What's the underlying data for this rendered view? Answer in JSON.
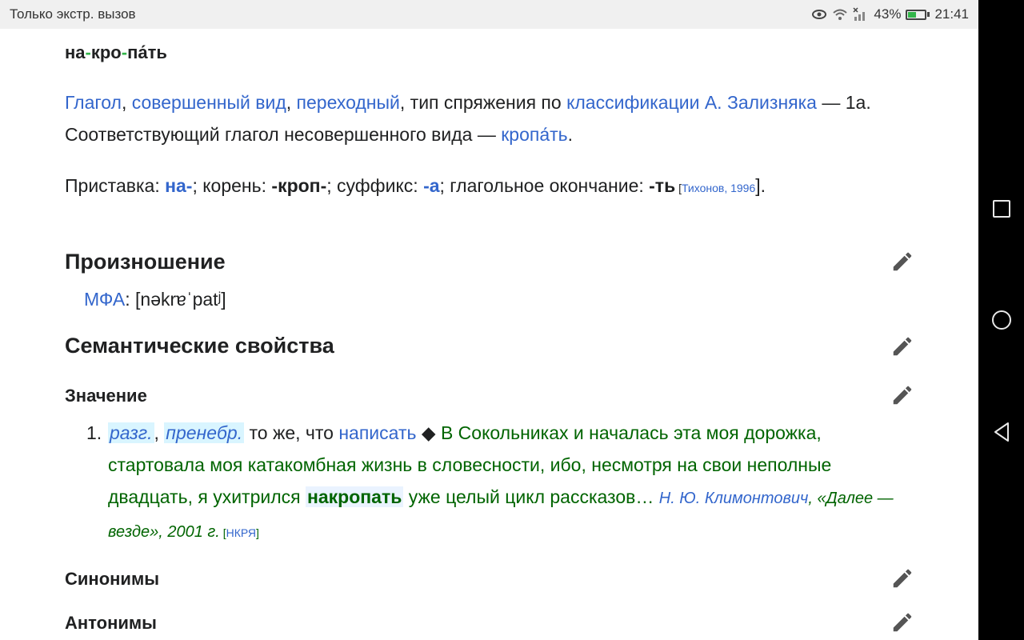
{
  "status_bar": {
    "left_text": "Только экстр. вызов",
    "battery": "43%",
    "time": "21:41"
  },
  "headword": {
    "p1": "на",
    "sep1": "-",
    "p2": "кро",
    "sep2": "-",
    "p3": "па́ть"
  },
  "grammar": {
    "verb": "Глагол",
    "comma1": ", ",
    "aspect": "совершенный вид",
    "comma2": ", ",
    "transitivity": "переходный",
    "conj_text": ", тип спряжения по ",
    "zaliznyak": "классификации А. Зализняка",
    "conj_type": " — 1a.",
    "imperfective_text": "Соответствующий глагол несовершенного вида — ",
    "imperfective_link": "кропа́ть",
    "period": "."
  },
  "morphemes": {
    "prefix_label": "Приставка: ",
    "prefix": "на-",
    "root_label": "; корень: ",
    "root": "-кроп-",
    "suffix_label": "; суффикс: ",
    "suffix": "-а",
    "ending_label": "; глагольное окончание: ",
    "ending": "-ть",
    "ref_open": " [",
    "ref": "Тихонов, 1996",
    "ref_close": "]."
  },
  "sections": {
    "pronunciation": "Произношение",
    "semantic": "Семантические свойства",
    "meaning": "Значение",
    "synonyms": "Синонимы",
    "antonyms": "Антонимы"
  },
  "ipa": {
    "label": "МФА",
    "value": ": [nəkrɐˈpatʲ]"
  },
  "meaning": {
    "number": "1.",
    "label1": "разг.",
    "comma": ", ",
    "label2": "пренебр.",
    "def_text": " то же, что ",
    "def_link": "написать",
    "diamond": " ◆ ",
    "example_before": "В Сокольниках и началась эта моя дорожка, стартовала моя катакомбная жизнь в словесности, ибо, несмотря на свои неполные двадцать, я ухитрился ",
    "example_highlight": "накропать",
    "example_after": " уже целый цикл рассказов… ",
    "author": "Н. Ю. Климонтович",
    "source": ", «Далее — везде», 2001 г.",
    "corpus_open": " [",
    "corpus": "НКРЯ",
    "corpus_close": "]"
  }
}
